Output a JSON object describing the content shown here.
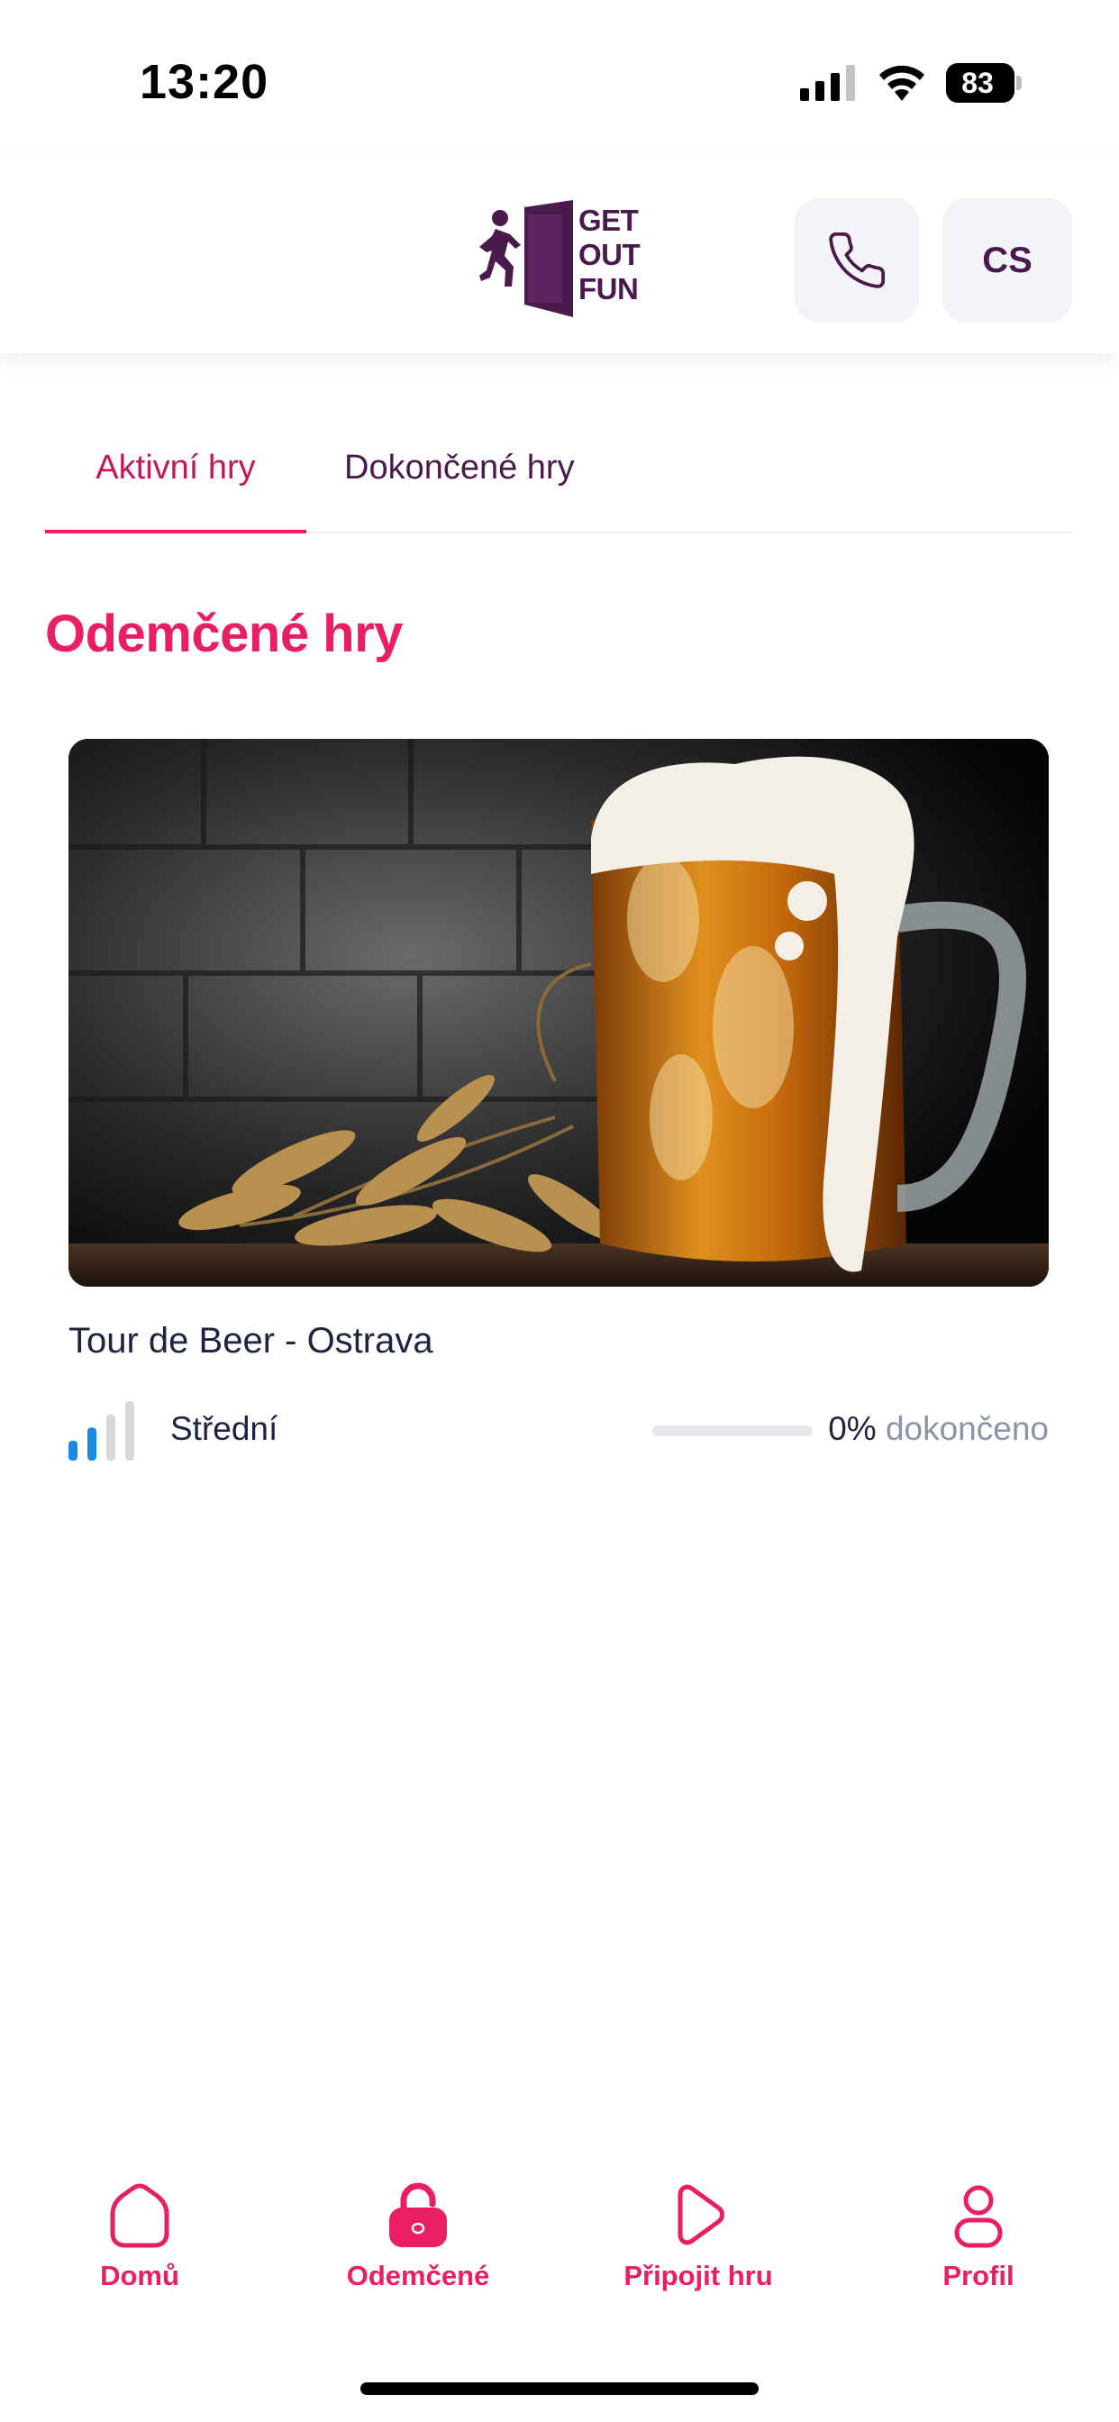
{
  "status_bar": {
    "time": "13:20",
    "battery": "83"
  },
  "header": {
    "logo_text": [
      "GET",
      "OUT",
      "FUN"
    ],
    "phone_icon": "phone-icon",
    "language": "CS"
  },
  "tabs": [
    {
      "label": "Aktivní hry",
      "active": true
    },
    {
      "label": "Dokončené hry",
      "active": false
    }
  ],
  "section_title": "Odemčené hry",
  "games": [
    {
      "title": "Tour de Beer - Ostrava",
      "difficulty": "Střední",
      "difficulty_level": 2,
      "difficulty_max": 4,
      "progress_value": "0%",
      "progress_suffix": "dokončeno",
      "progress_fraction": 0
    }
  ],
  "bottom_nav": [
    {
      "label": "Domů",
      "icon": "home-icon"
    },
    {
      "label": "Odemčené",
      "icon": "lock-open-icon",
      "active": true
    },
    {
      "label": "Připojit hru",
      "icon": "play-icon"
    },
    {
      "label": "Profil",
      "icon": "profile-icon"
    }
  ],
  "colors": {
    "accent": "#e91e63",
    "brand": "#4a1a4c",
    "difficulty_active": "#1e88e5",
    "difficulty_inactive": "#d8d8d8"
  }
}
